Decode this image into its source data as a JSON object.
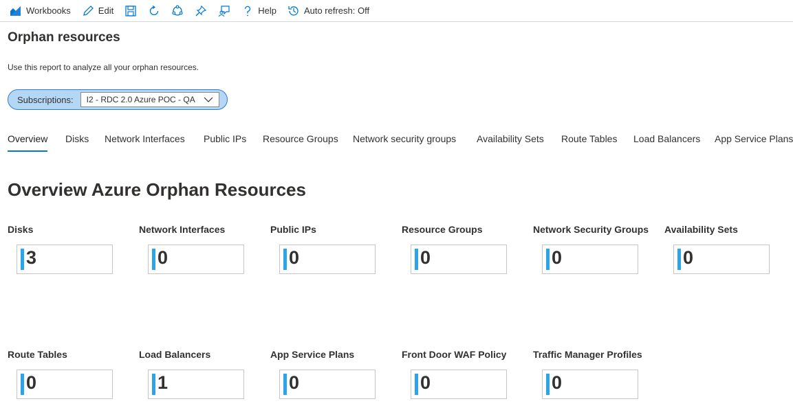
{
  "toolbar": {
    "workbooks_label": "Workbooks",
    "edit_label": "Edit",
    "help_label": "Help",
    "auto_refresh_label": "Auto refresh: Off",
    "icons": [
      "workbooks-icon",
      "edit-icon",
      "save-icon",
      "refresh-icon",
      "share-icon",
      "pin-icon",
      "feedback-icon",
      "help-icon",
      "auto-refresh-icon"
    ]
  },
  "page": {
    "title": "Orphan resources",
    "description": "Use this report to analyze all your orphan resources."
  },
  "parameter": {
    "label": "Subscriptions:",
    "value": "I2 - RDC 2.0 Azure POC - QA"
  },
  "tabs": [
    {
      "label": "Overview",
      "active": true
    },
    {
      "label": "Disks"
    },
    {
      "label": "Network Interfaces"
    },
    {
      "label": "Public IPs"
    },
    {
      "label": "Resource Groups"
    },
    {
      "label": "Network security groups"
    },
    {
      "label": "Availability Sets"
    },
    {
      "label": "Route Tables"
    },
    {
      "label": "Load Balancers"
    },
    {
      "label": "App Service Plans"
    }
  ],
  "section_title": "Overview Azure Orphan Resources",
  "tiles": [
    {
      "title": "Disks",
      "value": "3"
    },
    {
      "title": "Network Interfaces",
      "value": "0"
    },
    {
      "title": "Public IPs",
      "value": "0"
    },
    {
      "title": "Resource Groups",
      "value": "0"
    },
    {
      "title": "Network Security Groups",
      "value": "0"
    },
    {
      "title": "Availability Sets",
      "value": "0"
    },
    {
      "title": "Route Tables",
      "value": "0"
    },
    {
      "title": "Load Balancers",
      "value": "1"
    },
    {
      "title": "App Service Plans",
      "value": "0"
    },
    {
      "title": "Front Door WAF Policy",
      "value": "0"
    },
    {
      "title": "Traffic Manager Profiles",
      "value": "0"
    }
  ],
  "colors": {
    "accent": "#0078d4",
    "tile_bar": "#2ea4e8",
    "pill_bg": "#b3d7f5"
  }
}
